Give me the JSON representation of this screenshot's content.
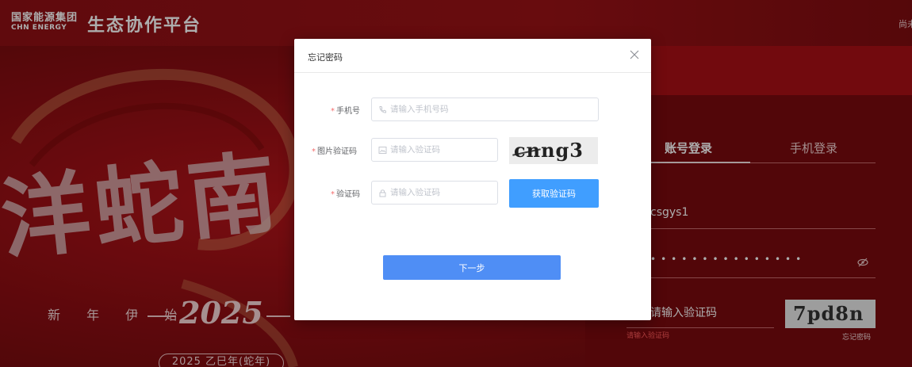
{
  "header": {
    "logo_cn": "国家能源集团",
    "logo_en": "CHN ENERGY",
    "platform_title": "生态协作平台",
    "corner_text": "尚未"
  },
  "background": {
    "calligraphy": "洋蛇南",
    "year_phrase": "新 年 伊 始",
    "year_art": "2025",
    "year_pill": "2025 乙巳年(蛇年)"
  },
  "login_panel": {
    "tabs": [
      {
        "label": "账号登录",
        "active": true
      },
      {
        "label": "手机登录",
        "active": false
      }
    ],
    "username_value": "csgys1",
    "password_mask": "•••••••••••••••",
    "captcha_placeholder": "请输入验证码",
    "captcha_error": "请输入验证码",
    "captcha_text": "7pd8n",
    "forgot_link": "忘记密码"
  },
  "modal": {
    "title": "忘记密码",
    "fields": {
      "phone": {
        "label": "手机号",
        "placeholder": "请输入手机号码",
        "value": ""
      },
      "image_code": {
        "label": "图片验证码",
        "placeholder": "请输入验证码",
        "value": ""
      },
      "sms_code": {
        "label": "验证码",
        "placeholder": "请输入验证码",
        "value": ""
      }
    },
    "captcha_text": "cnng3",
    "get_code_button": "获取验证码",
    "next_button": "下一步"
  },
  "colors": {
    "primary_button": "#409eff",
    "next_button": "#4f8ef5",
    "required_star": "#f56c6c",
    "brand_red": "#9a1216"
  },
  "icons": {
    "phone": "phone-icon",
    "image": "image-icon",
    "lock": "lock-icon",
    "close": "close-icon",
    "eye": "eye-off-icon"
  }
}
